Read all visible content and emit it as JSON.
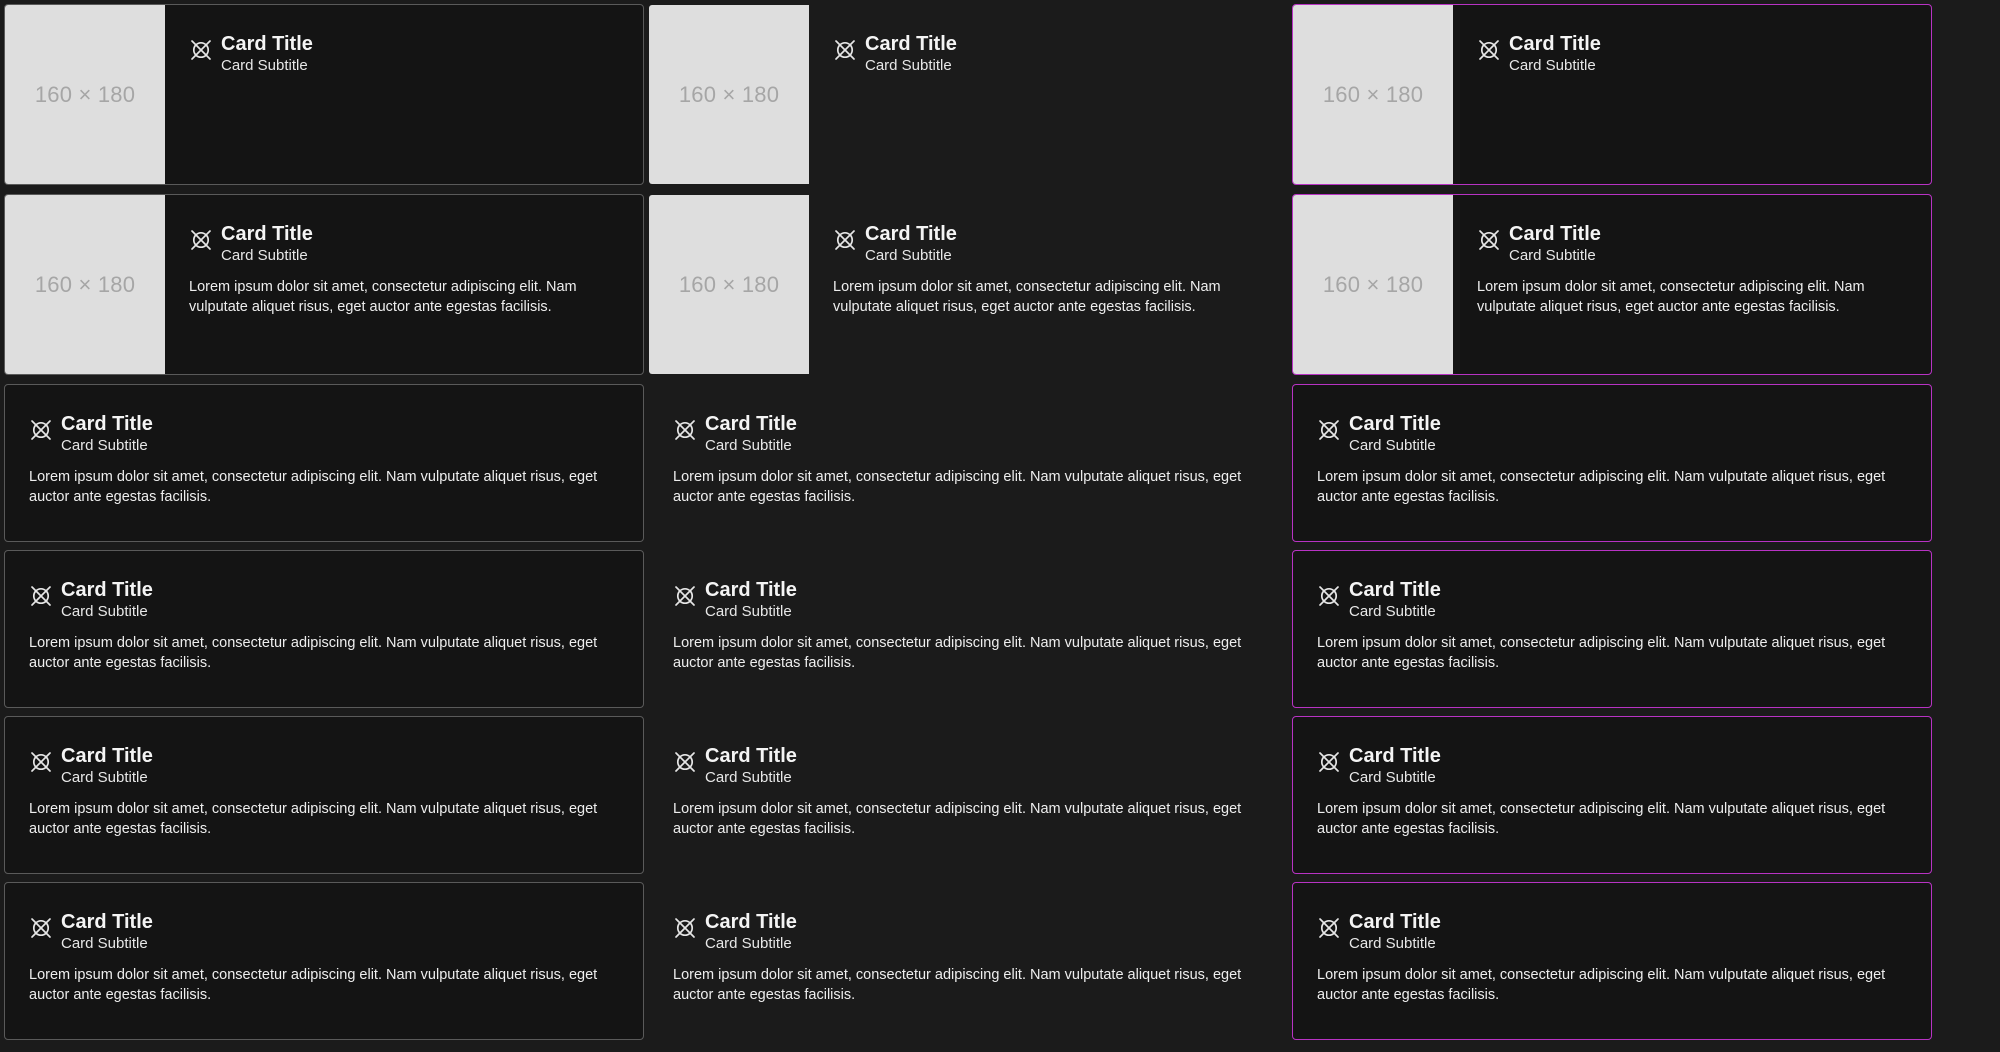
{
  "colors": {
    "page_background": "#1b1b1b",
    "card_background": "#141414",
    "outlined_border": "#5a5a5a",
    "accent_border": "#b833c4",
    "media_placeholder": "#dedede",
    "media_placeholder_text": "#a6a6a6"
  },
  "icon_name": "x-circle-icon",
  "cards": [
    {
      "variant": "outlined",
      "media": "160 × 180",
      "title": "Card Title",
      "subtitle": "Card Subtitle",
      "text": ""
    },
    {
      "variant": "flat",
      "media": "160 × 180",
      "title": "Card Title",
      "subtitle": "Card Subtitle",
      "text": ""
    },
    {
      "variant": "accent",
      "media": "160 × 180",
      "title": "Card Title",
      "subtitle": "Card Subtitle",
      "text": ""
    },
    {
      "variant": "outlined",
      "media": "160 × 180",
      "title": "Card Title",
      "subtitle": "Card Subtitle",
      "text": "Lorem ipsum dolor sit amet, consectetur adipiscing elit. Nam vulputate aliquet risus, eget auctor ante egestas facilisis."
    },
    {
      "variant": "flat",
      "media": "160 × 180",
      "title": "Card Title",
      "subtitle": "Card Subtitle",
      "text": "Lorem ipsum dolor sit amet, consectetur adipiscing elit. Nam vulputate aliquet risus, eget auctor ante egestas facilisis."
    },
    {
      "variant": "accent",
      "media": "160 × 180",
      "title": "Card Title",
      "subtitle": "Card Subtitle",
      "text": "Lorem ipsum dolor sit amet, consectetur adipiscing elit. Nam vulputate aliquet risus, eget auctor ante egestas facilisis."
    },
    {
      "variant": "outlined",
      "media": "",
      "title": "Card Title",
      "subtitle": "Card Subtitle",
      "text": "Lorem ipsum dolor sit amet, consectetur adipiscing elit. Nam vulputate aliquet risus, eget auctor ante egestas facilisis."
    },
    {
      "variant": "flat",
      "media": "",
      "title": "Card Title",
      "subtitle": "Card Subtitle",
      "text": "Lorem ipsum dolor sit amet, consectetur adipiscing elit. Nam vulputate aliquet risus, eget auctor ante egestas facilisis."
    },
    {
      "variant": "accent",
      "media": "",
      "title": "Card Title",
      "subtitle": "Card Subtitle",
      "text": "Lorem ipsum dolor sit amet, consectetur adipiscing elit. Nam vulputate aliquet risus, eget auctor ante egestas facilisis."
    },
    {
      "variant": "outlined",
      "media": "",
      "title": "Card Title",
      "subtitle": "Card Subtitle",
      "text": "Lorem ipsum dolor sit amet, consectetur adipiscing elit. Nam vulputate aliquet risus, eget auctor ante egestas facilisis."
    },
    {
      "variant": "flat",
      "media": "",
      "title": "Card Title",
      "subtitle": "Card Subtitle",
      "text": "Lorem ipsum dolor sit amet, consectetur adipiscing elit. Nam vulputate aliquet risus, eget auctor ante egestas facilisis."
    },
    {
      "variant": "accent",
      "media": "",
      "title": "Card Title",
      "subtitle": "Card Subtitle",
      "text": "Lorem ipsum dolor sit amet, consectetur adipiscing elit. Nam vulputate aliquet risus, eget auctor ante egestas facilisis."
    },
    {
      "variant": "outlined",
      "media": "",
      "title": "Card Title",
      "subtitle": "Card Subtitle",
      "text": "Lorem ipsum dolor sit amet, consectetur adipiscing elit. Nam vulputate aliquet risus, eget auctor ante egestas facilisis."
    },
    {
      "variant": "flat",
      "media": "",
      "title": "Card Title",
      "subtitle": "Card Subtitle",
      "text": "Lorem ipsum dolor sit amet, consectetur adipiscing elit. Nam vulputate aliquet risus, eget auctor ante egestas facilisis."
    },
    {
      "variant": "accent",
      "media": "",
      "title": "Card Title",
      "subtitle": "Card Subtitle",
      "text": "Lorem ipsum dolor sit amet, consectetur adipiscing elit. Nam vulputate aliquet risus, eget auctor ante egestas facilisis."
    },
    {
      "variant": "outlined",
      "media": "",
      "title": "Card Title",
      "subtitle": "Card Subtitle",
      "text": "Lorem ipsum dolor sit amet, consectetur adipiscing elit. Nam vulputate aliquet risus, eget auctor ante egestas facilisis."
    },
    {
      "variant": "flat",
      "media": "",
      "title": "Card Title",
      "subtitle": "Card Subtitle",
      "text": "Lorem ipsum dolor sit amet, consectetur adipiscing elit. Nam vulputate aliquet risus, eget auctor ante egestas facilisis."
    },
    {
      "variant": "accent",
      "media": "",
      "title": "Card Title",
      "subtitle": "Card Subtitle",
      "text": "Lorem ipsum dolor sit amet, consectetur adipiscing elit. Nam vulputate aliquet risus, eget auctor ante egestas facilisis."
    }
  ]
}
